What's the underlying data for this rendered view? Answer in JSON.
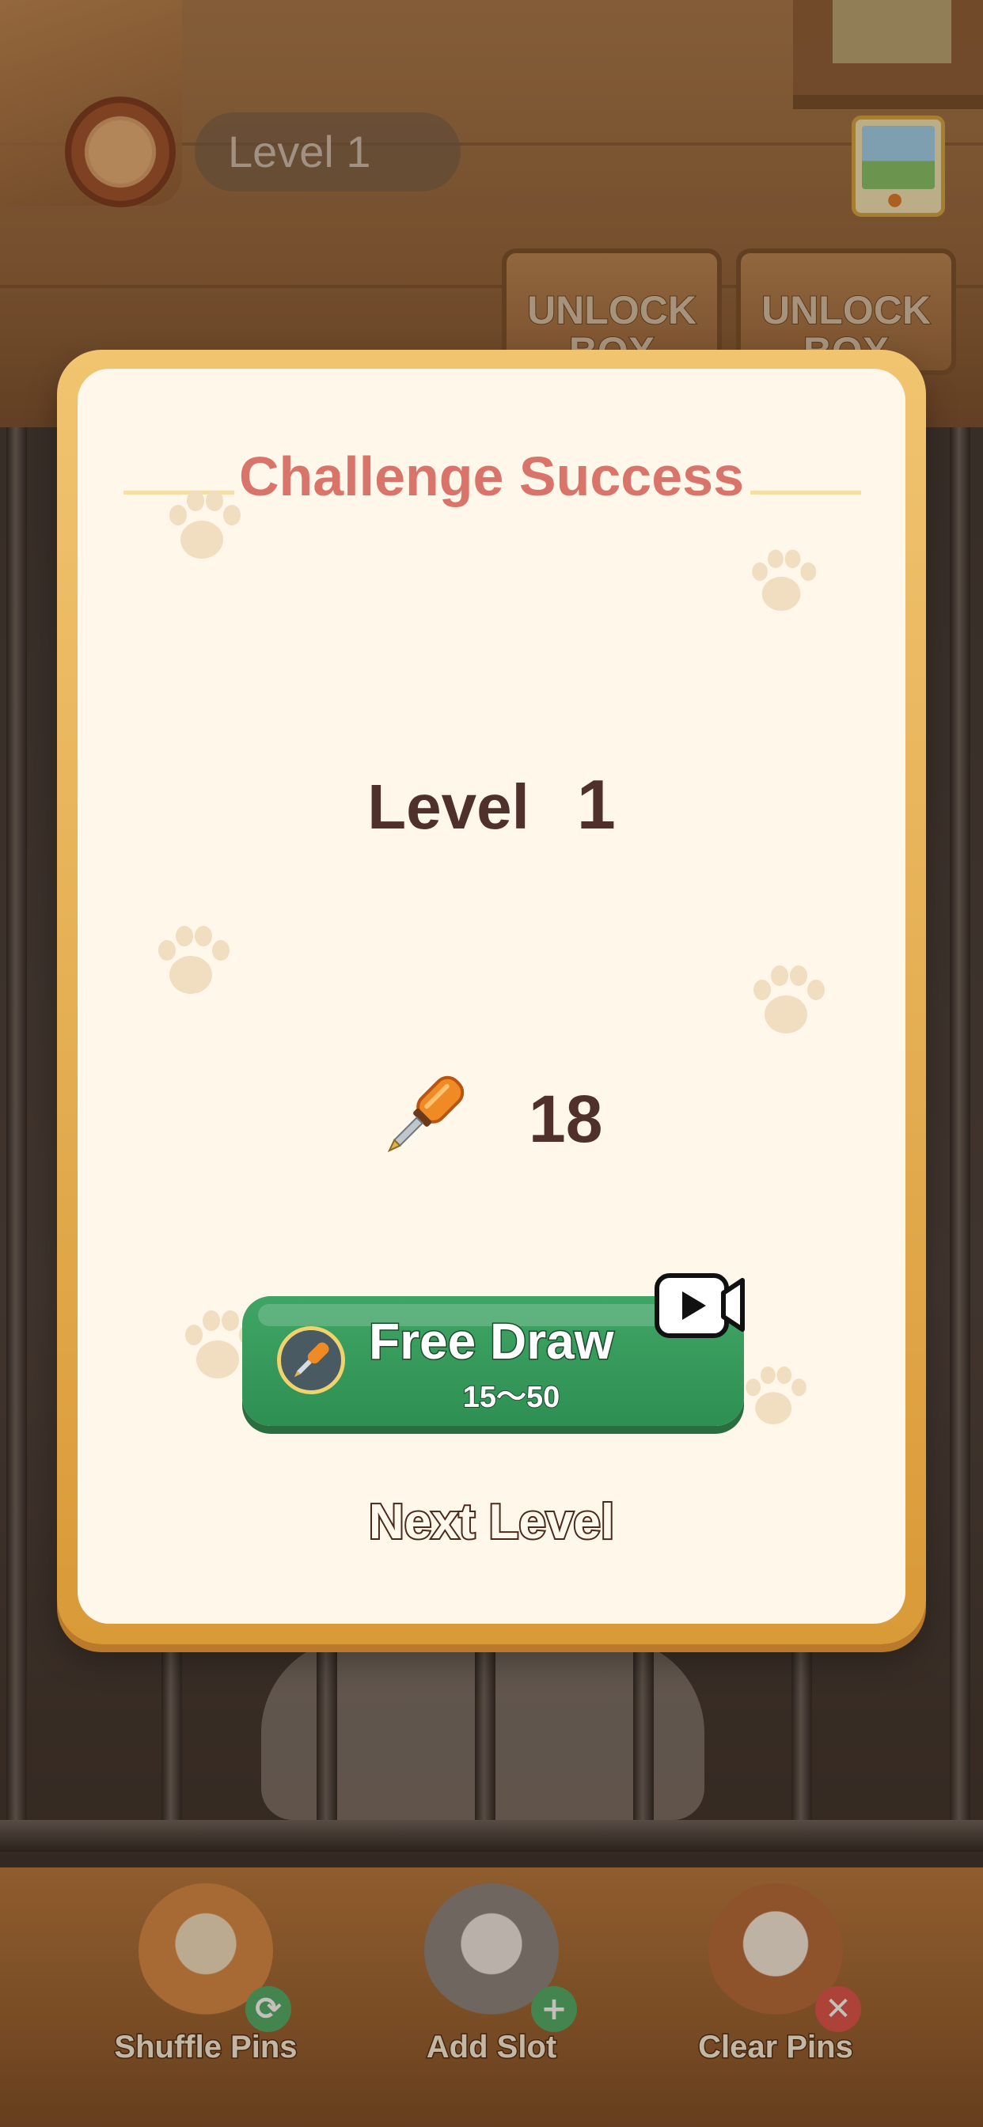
{
  "hud": {
    "level_text": "Level  1",
    "unlock_boxes": [
      {
        "label": "UNLOCK BOX"
      },
      {
        "label": "UNLOCK BOX"
      }
    ]
  },
  "modal": {
    "title": "Challenge Success",
    "level_word": "Level",
    "level_number": "1",
    "reward_count": "18",
    "free_draw": {
      "label": "Free Draw",
      "range": "15～50"
    },
    "next_level_label": "Next Level"
  },
  "toolbar": {
    "items": [
      {
        "label": "Shuffle Pins",
        "icon": "shuffle-icon"
      },
      {
        "label": "Add Slot",
        "icon": "plus-icon"
      },
      {
        "label": "Clear Pins",
        "icon": "close-icon"
      }
    ]
  },
  "colors": {
    "title": "#d9746b",
    "modal_border": "#e4ad50",
    "modal_bg": "#fff7ea",
    "button_green": "#37995b",
    "text_dark": "#4f302b"
  }
}
